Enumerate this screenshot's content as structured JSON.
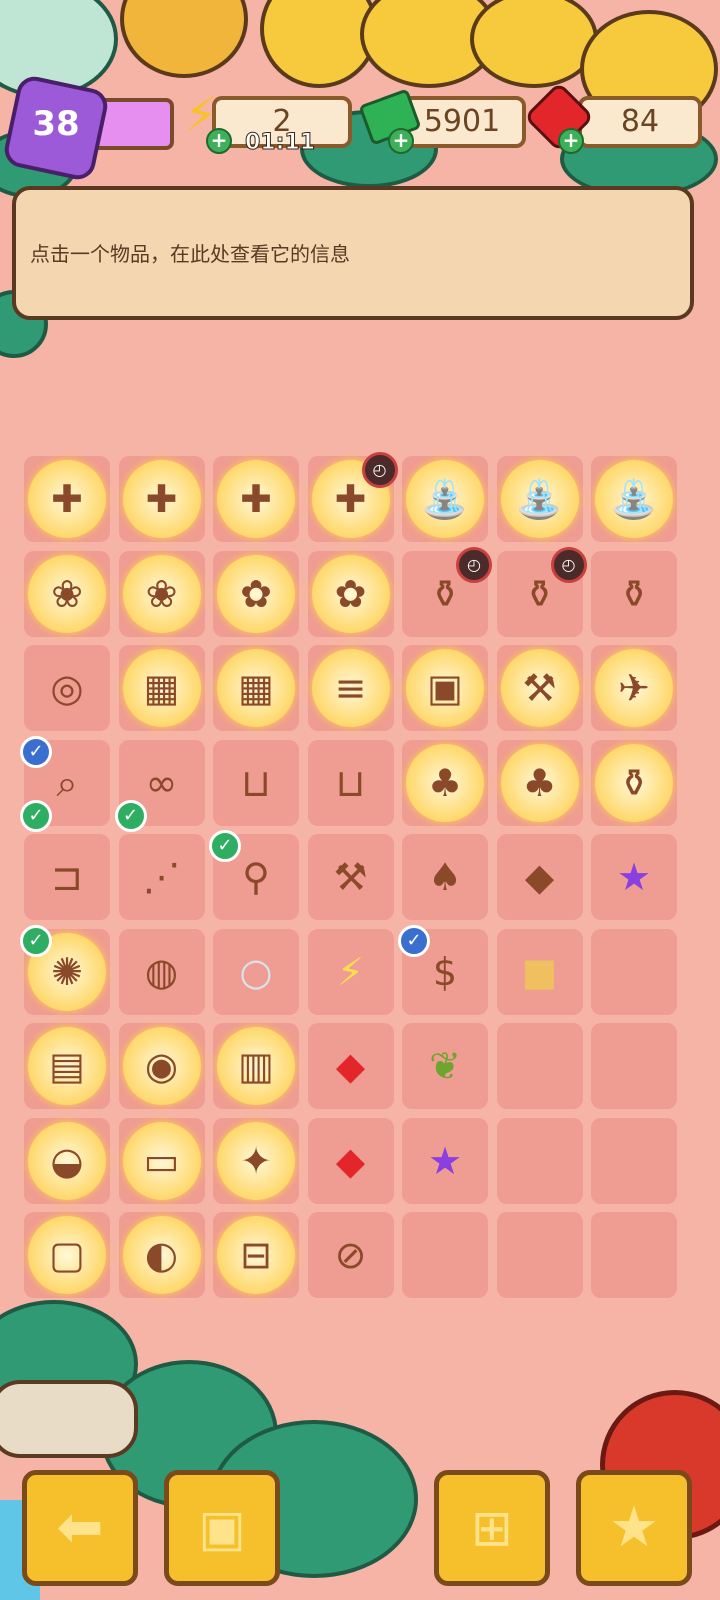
{
  "hud": {
    "level": "38",
    "energy": "2",
    "energy_timer": "01:11",
    "cash": "5901",
    "gems": "84"
  },
  "info_panel": {
    "text": "点击一个物品，在此处查看它的信息"
  },
  "board": {
    "rows": [
      [
        "medkit-bubble",
        "medkit-bubble",
        "medkit-bubble",
        "medkit-bubble",
        "fountain-bubble",
        "fountain-bubble",
        "fountain-bubble"
      ],
      [
        "plant-pot-bubble",
        "plant-pot-bubble",
        "flower-basket-bubble",
        "flower-basket-bubble",
        "vase-broken",
        "vase-blue",
        "vase-white"
      ],
      [
        "binoculars",
        "crate-bubble",
        "crate-bubble",
        "pipes-bubble",
        "box-bubble",
        "tools-bubble",
        "helicopter-bubble"
      ],
      [
        "spyglass",
        "sunglasses",
        "flower-pot-empty",
        "flower-pot-broken",
        "coin-bag-bubble",
        "coin-bag-bubble",
        "jar-bubble"
      ],
      [
        "hand-saw",
        "saw",
        "broom",
        "axe",
        "shovel",
        "trowel",
        "purple-star-jelly"
      ],
      [
        "chandelier-bubble",
        "lamp-base",
        "light-bulb",
        "energy-orb",
        "money-poster",
        "sugar-cubes",
        "empty"
      ],
      [
        "desk-bubble",
        "pot-bubble",
        "chest-bubble",
        "ruby",
        "seed-bag",
        "empty",
        "empty"
      ],
      [
        "bathtub-bubble",
        "pool-bubble",
        "toy-bubble",
        "gem-bucket",
        "purple-star",
        "empty",
        "empty"
      ],
      [
        "tv-bubble",
        "console-bubble",
        "cart-bubble",
        "zip-bag",
        "empty",
        "empty",
        "empty"
      ]
    ]
  },
  "colors": {
    "background": "#f6b4a6",
    "cell": "#ef9c92",
    "panel": "#f4d6b0",
    "button": "#f6c02d"
  },
  "buttons": {
    "back": "arrow-left-icon",
    "bag": "backpack-icon",
    "sell": "basket-icon",
    "orders": "clipboard-star-icon"
  }
}
